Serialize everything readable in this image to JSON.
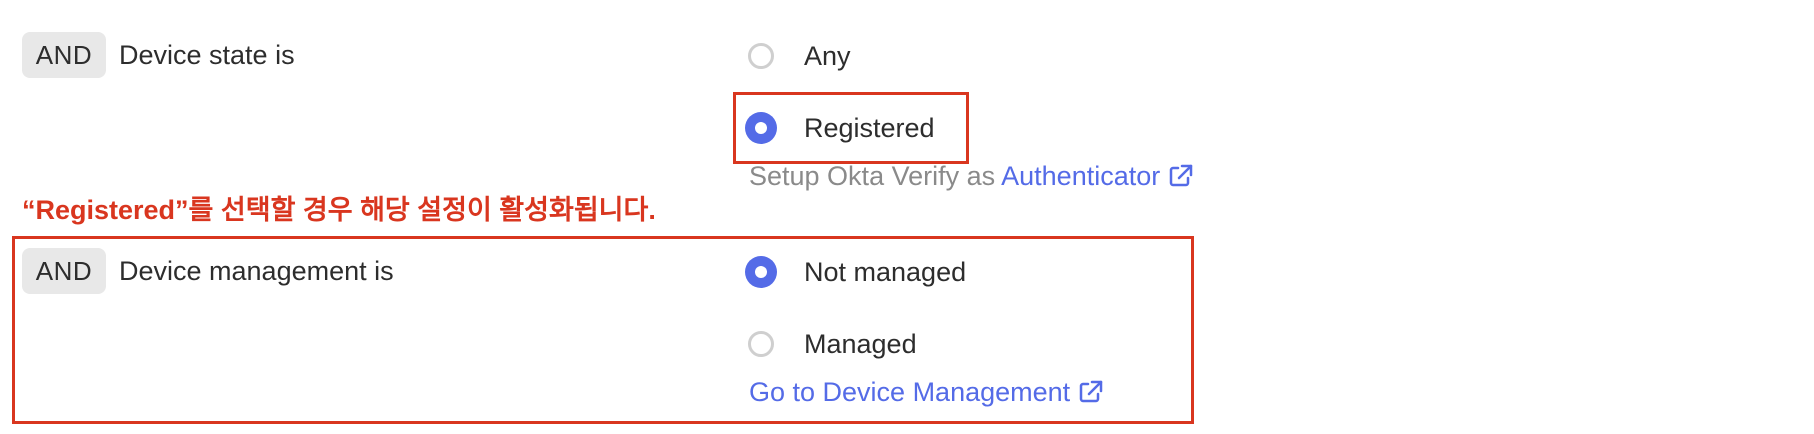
{
  "colors": {
    "accent": "#546be7",
    "annotation": "#d9361f",
    "badge_bg": "#e8e8e8",
    "text": "#2d2d2d",
    "muted": "#8a8a8a"
  },
  "device_state": {
    "operator": "AND",
    "label": "Device state is",
    "options": [
      {
        "label": "Any",
        "selected": false
      },
      {
        "label": "Registered",
        "selected": true
      }
    ],
    "hint_prefix": "Setup Okta Verify as",
    "hint_link": "Authenticator",
    "hint_link_icon": "external-link-icon"
  },
  "annotation": {
    "text": "“Registered”를 선택할 경우 해당 설정이 활성화됩니다."
  },
  "device_management": {
    "operator": "AND",
    "label": "Device management is",
    "options": [
      {
        "label": "Not managed",
        "selected": true
      },
      {
        "label": "Managed",
        "selected": false
      }
    ],
    "link": "Go to Device Management",
    "link_icon": "external-link-icon"
  }
}
